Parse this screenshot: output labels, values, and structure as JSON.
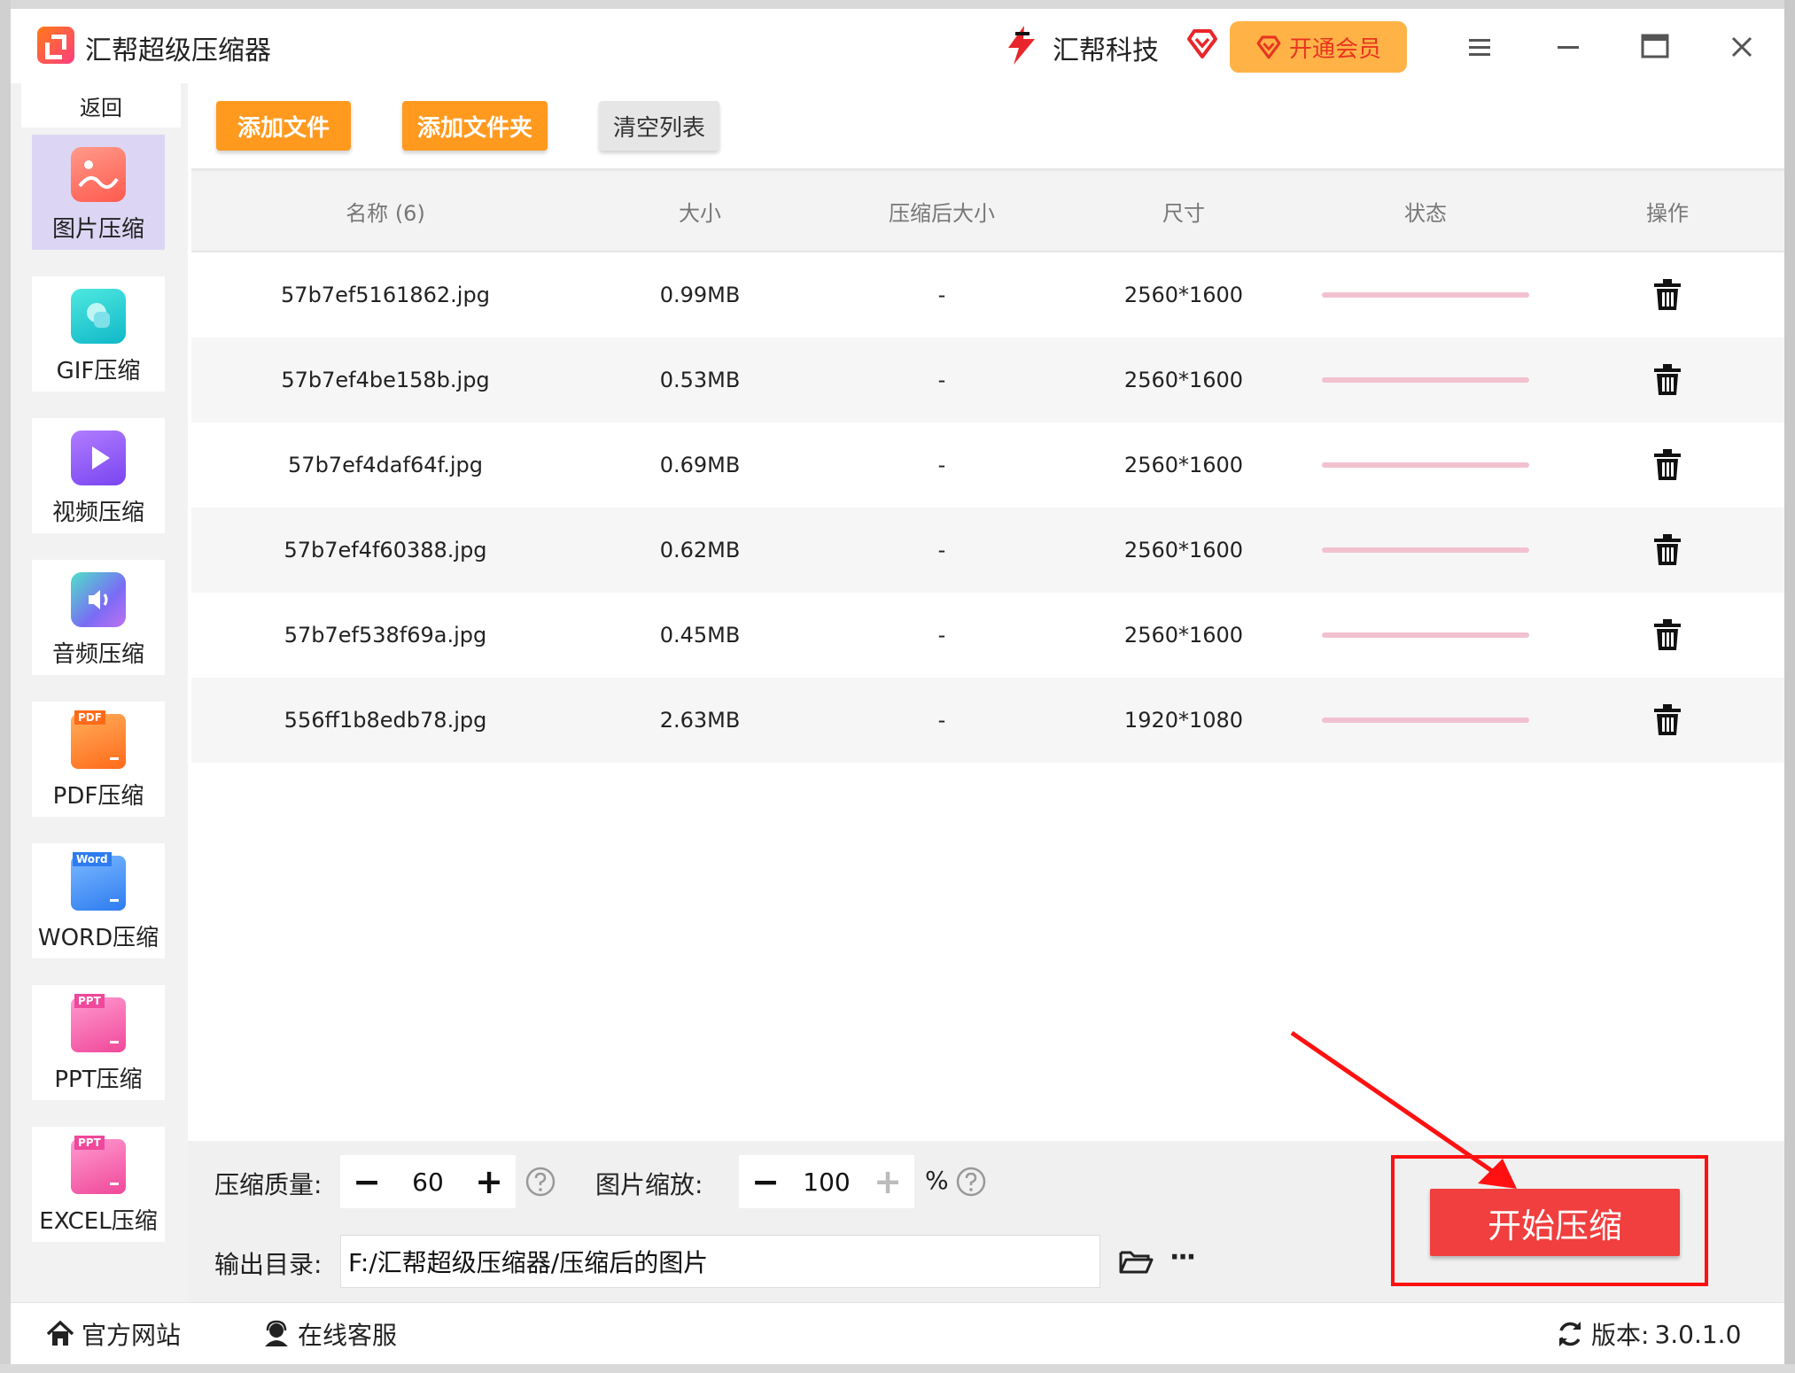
{
  "app": {
    "title": "汇帮超级压缩器",
    "brand": "汇帮科技",
    "vip_label": "开通会员"
  },
  "sidebar": {
    "back": "返回",
    "items": [
      {
        "label": "图片压缩",
        "icon": "image-compress-icon",
        "active": true,
        "color": "#ff6f61"
      },
      {
        "label": "GIF压缩",
        "icon": "gif-compress-icon",
        "active": false,
        "color": "#13c6c6"
      },
      {
        "label": "视频压缩",
        "icon": "video-compress-icon",
        "active": false,
        "color": "#8a5cf5"
      },
      {
        "label": "音频压缩",
        "icon": "audio-compress-icon",
        "active": false,
        "color": "#5a8cf0"
      },
      {
        "label": "PDF压缩",
        "icon": "pdf-compress-icon",
        "active": false,
        "color": "#ff8a2a"
      },
      {
        "label": "WORD压缩",
        "icon": "word-compress-icon",
        "active": false,
        "color": "#3b8cf5"
      },
      {
        "label": "PPT压缩",
        "icon": "ppt-compress-icon",
        "active": false,
        "color": "#f55aa8"
      },
      {
        "label": "EXCEL压缩",
        "icon": "excel-compress-icon",
        "active": false,
        "color": "#f55aa8"
      }
    ],
    "badges": {
      "pdf": "PDF",
      "word": "Word",
      "ppt": "PPT",
      "excel": "PPT"
    }
  },
  "toolbar": {
    "add_file": "添加文件",
    "add_folder": "添加文件夹",
    "clear_list": "清空列表"
  },
  "table": {
    "headers": [
      "名称 (6)",
      "大小",
      "压缩后大小",
      "尺寸",
      "状态",
      "操作"
    ],
    "rows": [
      {
        "name": "57b7ef5161862.jpg",
        "size": "0.99MB",
        "compressed": "-",
        "dims": "2560*1600"
      },
      {
        "name": "57b7ef4be158b.jpg",
        "size": "0.53MB",
        "compressed": "-",
        "dims": "2560*1600"
      },
      {
        "name": "57b7ef4daf64f.jpg",
        "size": "0.69MB",
        "compressed": "-",
        "dims": "2560*1600"
      },
      {
        "name": "57b7ef4f60388.jpg",
        "size": "0.62MB",
        "compressed": "-",
        "dims": "2560*1600"
      },
      {
        "name": "57b7ef538f69a.jpg",
        "size": "0.45MB",
        "compressed": "-",
        "dims": "2560*1600"
      },
      {
        "name": "556ff1b8edb78.jpg",
        "size": "2.63MB",
        "compressed": "-",
        "dims": "1920*1080"
      }
    ]
  },
  "settings": {
    "quality_label": "压缩质量:",
    "quality_value": "60",
    "scale_label": "图片缩放:",
    "scale_value": "100",
    "scale_unit": "%",
    "output_label": "输出目录:",
    "output_path": "F:/汇帮超级压缩器/压缩后的图片",
    "minus": "−",
    "plus": "+",
    "more": "···"
  },
  "start_button": "开始压缩",
  "footer": {
    "website": "官方网站",
    "support": "在线客服",
    "version_label": "版本:",
    "version": "3.0.1.0"
  },
  "colors": {
    "accent_orange": "#ff9a1f",
    "start_red": "#f13e3e",
    "vip_bg": "#ffb347",
    "status_pink": "#f2c1cf"
  }
}
